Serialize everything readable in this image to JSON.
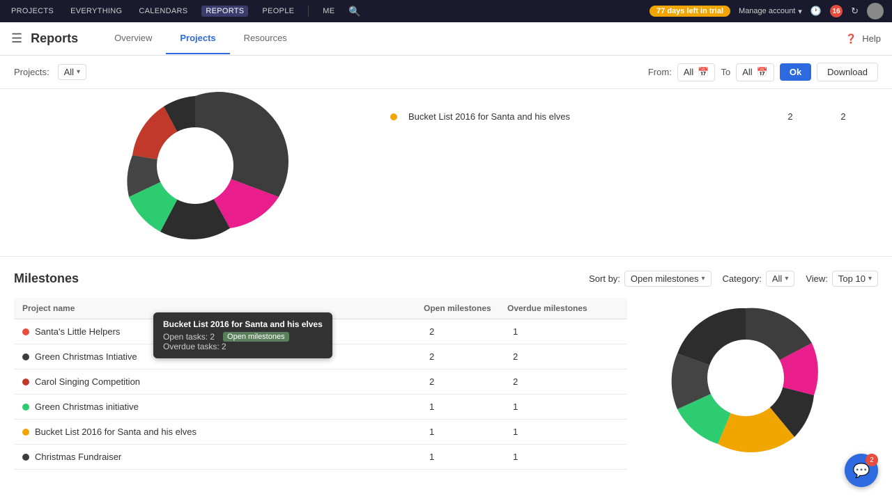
{
  "topnav": {
    "items": [
      "PROJECTS",
      "EVERYTHING",
      "CALENDARS",
      "REPORTS",
      "PEOPLE",
      "ME"
    ],
    "active": "REPORTS",
    "trial": "77 days left in trial",
    "manageAccount": "Manage account",
    "notifCount": "16"
  },
  "appHeader": {
    "title": "Reports",
    "tabs": [
      "Overview",
      "Projects",
      "Resources"
    ],
    "activeTab": "Projects",
    "help": "Help"
  },
  "toolbar": {
    "projectsLabel": "Projects:",
    "projectsValue": "All",
    "fromLabel": "From:",
    "fromValue": "All",
    "toLabel": "To",
    "toValue": "All",
    "okLabel": "Ok",
    "downloadLabel": "Download"
  },
  "bucketList": {
    "dot": "#f0a500",
    "name": "Bucket List 2016 for Santa and his elves",
    "openMilestones": "2",
    "overdueMilestones": "2"
  },
  "milestones": {
    "title": "Milestones",
    "sortByLabel": "Sort by:",
    "sortByValue": "Open milestones",
    "categoryLabel": "Category:",
    "categoryValue": "All",
    "viewLabel": "View:",
    "viewValue": "Top 10",
    "tableHeaders": [
      "Project name",
      "Open milestones",
      "Overdue milestones"
    ],
    "rows": [
      {
        "dot": "#e74c3c",
        "name": "Santa's Little Helpers",
        "open": "2",
        "overdue": "1"
      },
      {
        "dot": "#3d3d3d",
        "name": "Green Christmas Intiative",
        "open": "2",
        "overdue": "2"
      },
      {
        "dot": "#c0392b",
        "name": "Carol Singing Competition",
        "open": "2",
        "overdue": "2"
      },
      {
        "dot": "#2ecc71",
        "name": "Green Christmas initiative",
        "open": "1",
        "overdue": "1"
      },
      {
        "dot": "#f0a500",
        "name": "Bucket List 2016 for Santa and his elves",
        "open": "1",
        "overdue": "1"
      },
      {
        "dot": "#3d3d3d",
        "name": "Christmas Fundraiser",
        "open": "1",
        "overdue": "1"
      }
    ],
    "tooltip": {
      "title": "Bucket List 2016 for Santa and his elves",
      "openTasks": "Open tasks: 2",
      "badge": "Open milestones",
      "overdueTasks": "Overdue tasks: 2"
    }
  },
  "chat": {
    "icon": "💬",
    "badgeCount": "2"
  }
}
